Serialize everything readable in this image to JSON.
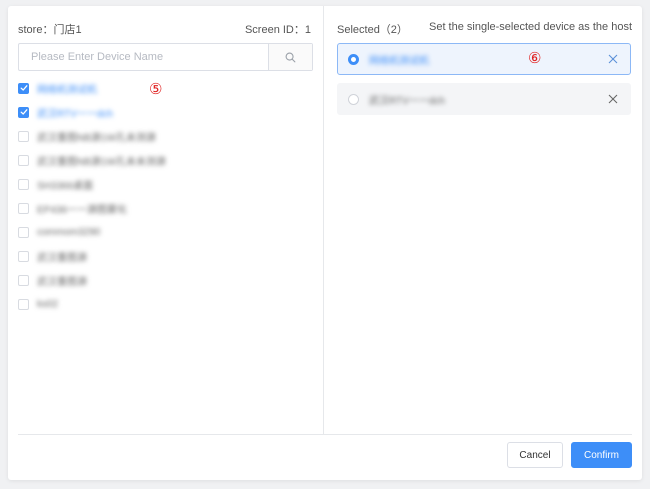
{
  "left": {
    "store_label": "store：门店1",
    "screen_id_label": "Screen ID：1",
    "search_placeholder": "Please Enter Device Name",
    "search_value": "",
    "devices": [
      {
        "name": "网络机测试机",
        "checked": true
      },
      {
        "name": "武汉RTV一一dch",
        "checked": true
      },
      {
        "name": "武汉重图NB源1W孔未测源",
        "checked": false
      },
      {
        "name": "武汉重图NB源1W孔未未测源",
        "checked": false
      },
      {
        "name": "SH3366桌面",
        "checked": false
      },
      {
        "name": "EP436一一源图雾化",
        "checked": false
      },
      {
        "name": "commom3290",
        "checked": false
      },
      {
        "name": "武汉重图源",
        "checked": false
      },
      {
        "name": "武汉重图源",
        "checked": false
      },
      {
        "name": "ks02",
        "checked": false
      }
    ],
    "marker": "⑤"
  },
  "right": {
    "selected_label": "Selected（2）",
    "hint_label": "Set the single-selected device as the host",
    "selected": [
      {
        "name": "网络机测试机",
        "host": true
      },
      {
        "name": "武汉RTV一一dch",
        "host": false
      }
    ],
    "marker": "⑥"
  },
  "footer": {
    "cancel_label": "Cancel",
    "confirm_label": "Confirm"
  },
  "colors": {
    "accent": "#3d8ef8",
    "marker": "#e02020"
  },
  "icons": {
    "search": "search-icon",
    "remove": "close-icon",
    "check": "check-icon"
  }
}
